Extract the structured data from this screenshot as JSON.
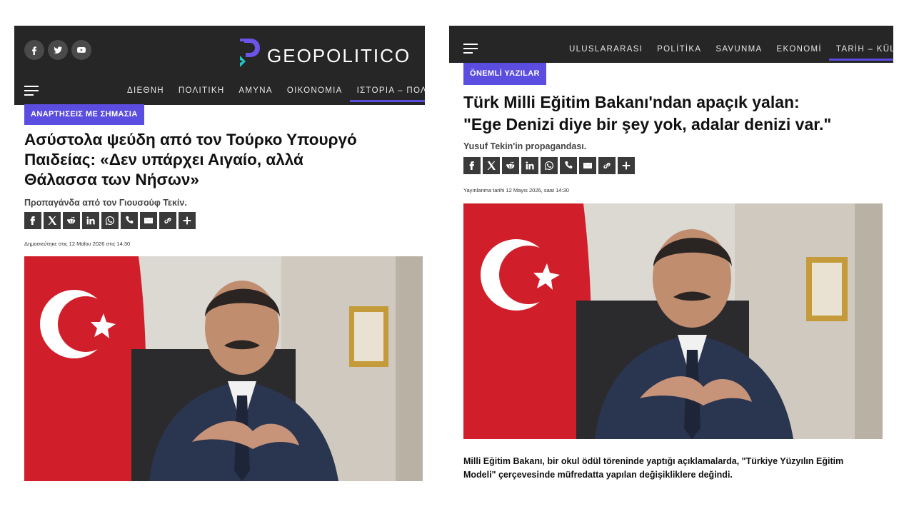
{
  "left": {
    "social": [
      {
        "icon": "facebook-icon",
        "glyph": "f"
      },
      {
        "icon": "twitter-icon"
      },
      {
        "icon": "youtube-icon"
      }
    ],
    "logo_text": "GEOPOLITICO",
    "nav": [
      "ΔΙΕΘΝΗ",
      "ΠΟΛΙΤΙΚΗ",
      "ΑΜΥΝΑ",
      "ΟΙΚΟΝΟΜΙΑ",
      "ΙΣΤΟΡΙΑ – ΠΟΛΙΤΙΣΜ"
    ],
    "tag": "ΑΝΑΡΤΗΣΕΙΣ ΜΕ ΣΗΜΑΣΙΑ",
    "title_lines": [
      "Ασύστολα ψεύδη από τον Τούρκο Υπουργό",
      "Παιδείας: «Δεν υπάρχει Αιγαίο, αλλά",
      "Θάλασσα των Νήσων»"
    ],
    "subtitle": "Προπαγάνδα από τον Γιουσούφ Τεκίν.",
    "published": "Δημοσιεύτηκε στις 12 Μαΐου 2026 στις 14:30"
  },
  "right": {
    "nav": [
      "ULUSLARARASI",
      "POLİTİKA",
      "SAVUNMA",
      "EKONOMİ",
      "TARİH – KÜLT"
    ],
    "tag": "ÖNEMLİ YAZILAR",
    "title_lines": [
      "Türk Milli Eğitim Bakanı'ndan apaçık yalan:",
      "\"Ege Denizi diye bir şey yok, adalar denizi var.\""
    ],
    "subtitle": "Yusuf Tekin'in propagandası.",
    "published": "Yayınlanma tarihi 12 Mayıs 2026, saat 14:30",
    "caption_lines": [
      "Milli Eğitim Bakanı, bir okul ödül töreninde yaptığı açıklamalarda, \"Türkiye Yüzyılın Eğitim",
      "Modeli\" çerçevesinde müfredatta yapılan değişikliklere değindi."
    ]
  },
  "share_icons": [
    "facebook-icon",
    "x-icon",
    "reddit-icon",
    "linkedin-icon",
    "whatsapp-icon",
    "viber-icon",
    "email-icon",
    "link-icon",
    "plus-icon"
  ],
  "colors": {
    "header_bg": "#262626",
    "accent": "#5b4de0",
    "logo_teal": "#1fc6c6",
    "share_bg": "#3a3a3a"
  }
}
